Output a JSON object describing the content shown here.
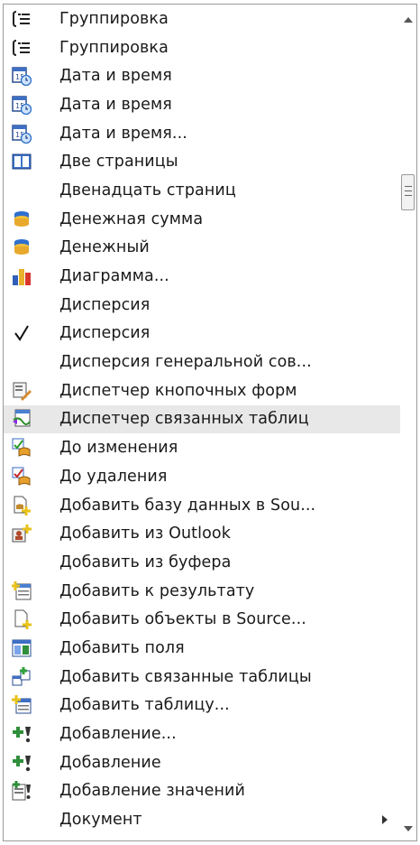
{
  "menu": {
    "items": [
      {
        "label": "Группировка",
        "icon": "grouping-icon",
        "highlighted": false,
        "submenu": false
      },
      {
        "label": "Группировка",
        "icon": "grouping-icon",
        "highlighted": false,
        "submenu": false
      },
      {
        "label": "Дата и время",
        "icon": "date-time-icon",
        "highlighted": false,
        "submenu": false
      },
      {
        "label": "Дата и время",
        "icon": "date-time-icon",
        "highlighted": false,
        "submenu": false
      },
      {
        "label": "Дата и время...",
        "icon": "date-time-icon",
        "highlighted": false,
        "submenu": false
      },
      {
        "label": "Две страницы",
        "icon": "two-pages-icon",
        "highlighted": false,
        "submenu": false
      },
      {
        "label": "Двенадцать страниц",
        "icon": "",
        "highlighted": false,
        "submenu": false
      },
      {
        "label": "Денежная сумма",
        "icon": "currency-icon",
        "highlighted": false,
        "submenu": false
      },
      {
        "label": "Денежный",
        "icon": "currency-icon",
        "highlighted": false,
        "submenu": false
      },
      {
        "label": "Диаграмма...",
        "icon": "chart-icon",
        "highlighted": false,
        "submenu": false
      },
      {
        "label": "Дисперсия",
        "icon": "",
        "highlighted": false,
        "submenu": false
      },
      {
        "label": "Дисперсия",
        "icon": "checkmark-icon",
        "highlighted": false,
        "submenu": false
      },
      {
        "label": "Дисперсия генеральной сов...",
        "icon": "",
        "highlighted": false,
        "submenu": false
      },
      {
        "label": "Диспетчер кнопочных форм",
        "icon": "switchboard-manager-icon",
        "highlighted": false,
        "submenu": false
      },
      {
        "label": "Диспетчер связанных таблиц",
        "icon": "linked-table-manager-icon",
        "highlighted": true,
        "submenu": false
      },
      {
        "label": "До изменения",
        "icon": "before-change-icon",
        "highlighted": false,
        "submenu": false
      },
      {
        "label": "До удаления",
        "icon": "before-delete-icon",
        "highlighted": false,
        "submenu": false
      },
      {
        "label": "Добавить базу данных в Sou...",
        "icon": "add-database-icon",
        "highlighted": false,
        "submenu": false
      },
      {
        "label": "Добавить из Outlook",
        "icon": "add-from-outlook-icon",
        "highlighted": false,
        "submenu": false
      },
      {
        "label": "Добавить из буфера",
        "icon": "",
        "highlighted": false,
        "submenu": false
      },
      {
        "label": "Добавить к результату",
        "icon": "add-to-result-icon",
        "highlighted": false,
        "submenu": false
      },
      {
        "label": "Добавить объекты в Source...",
        "icon": "add-objects-icon",
        "highlighted": false,
        "submenu": false
      },
      {
        "label": "Добавить поля",
        "icon": "add-fields-icon",
        "highlighted": false,
        "submenu": false
      },
      {
        "label": "Добавить связанные таблицы",
        "icon": "add-linked-tables-icon",
        "highlighted": false,
        "submenu": false
      },
      {
        "label": "Добавить таблицу...",
        "icon": "add-table-icon",
        "highlighted": false,
        "submenu": false
      },
      {
        "label": "Добавление...",
        "icon": "append-query-icon",
        "highlighted": false,
        "submenu": false
      },
      {
        "label": "Добавление",
        "icon": "append-query-icon",
        "highlighted": false,
        "submenu": false
      },
      {
        "label": "Добавление значений",
        "icon": "append-values-icon",
        "highlighted": false,
        "submenu": false
      },
      {
        "label": "Документ",
        "icon": "",
        "highlighted": false,
        "submenu": true
      }
    ]
  }
}
